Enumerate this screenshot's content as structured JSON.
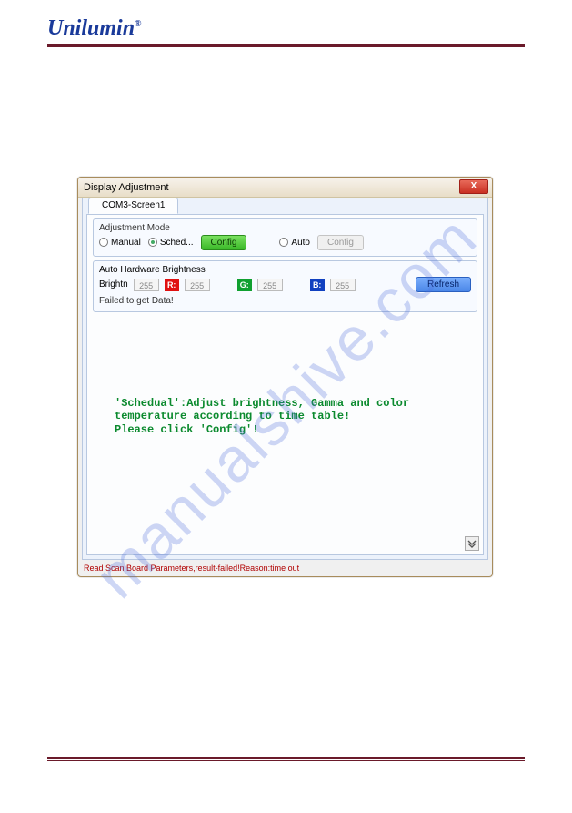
{
  "header": {
    "logo": "Unilumin"
  },
  "watermark": "manualshive.com",
  "window": {
    "title": "Display Adjustment",
    "close_glyph": "X",
    "tab": "COM3-Screen1",
    "adjustment_mode": {
      "legend": "Adjustment Mode",
      "manual": "Manual",
      "sched": "Sched...",
      "auto": "Auto",
      "config": "Config",
      "config2": "Config"
    },
    "hw": {
      "title": "Auto Hardware Brightness",
      "brightn_label": "Brightn",
      "brightn_val": "255",
      "r_label": "R:",
      "r_val": "255",
      "g_label": "G:",
      "g_val": "255",
      "b_label": "B:",
      "b_val": "255",
      "refresh": "Refresh",
      "fail": "Failed to get Data!"
    },
    "help": {
      "line1": "'Schedual':Adjust brightness, Gamma and color",
      "line2": "temperature according to time table!",
      "line3": "  Please click 'Config'!"
    },
    "status": "Read Scan Board Parameters,result-failed!Reason:time out"
  }
}
